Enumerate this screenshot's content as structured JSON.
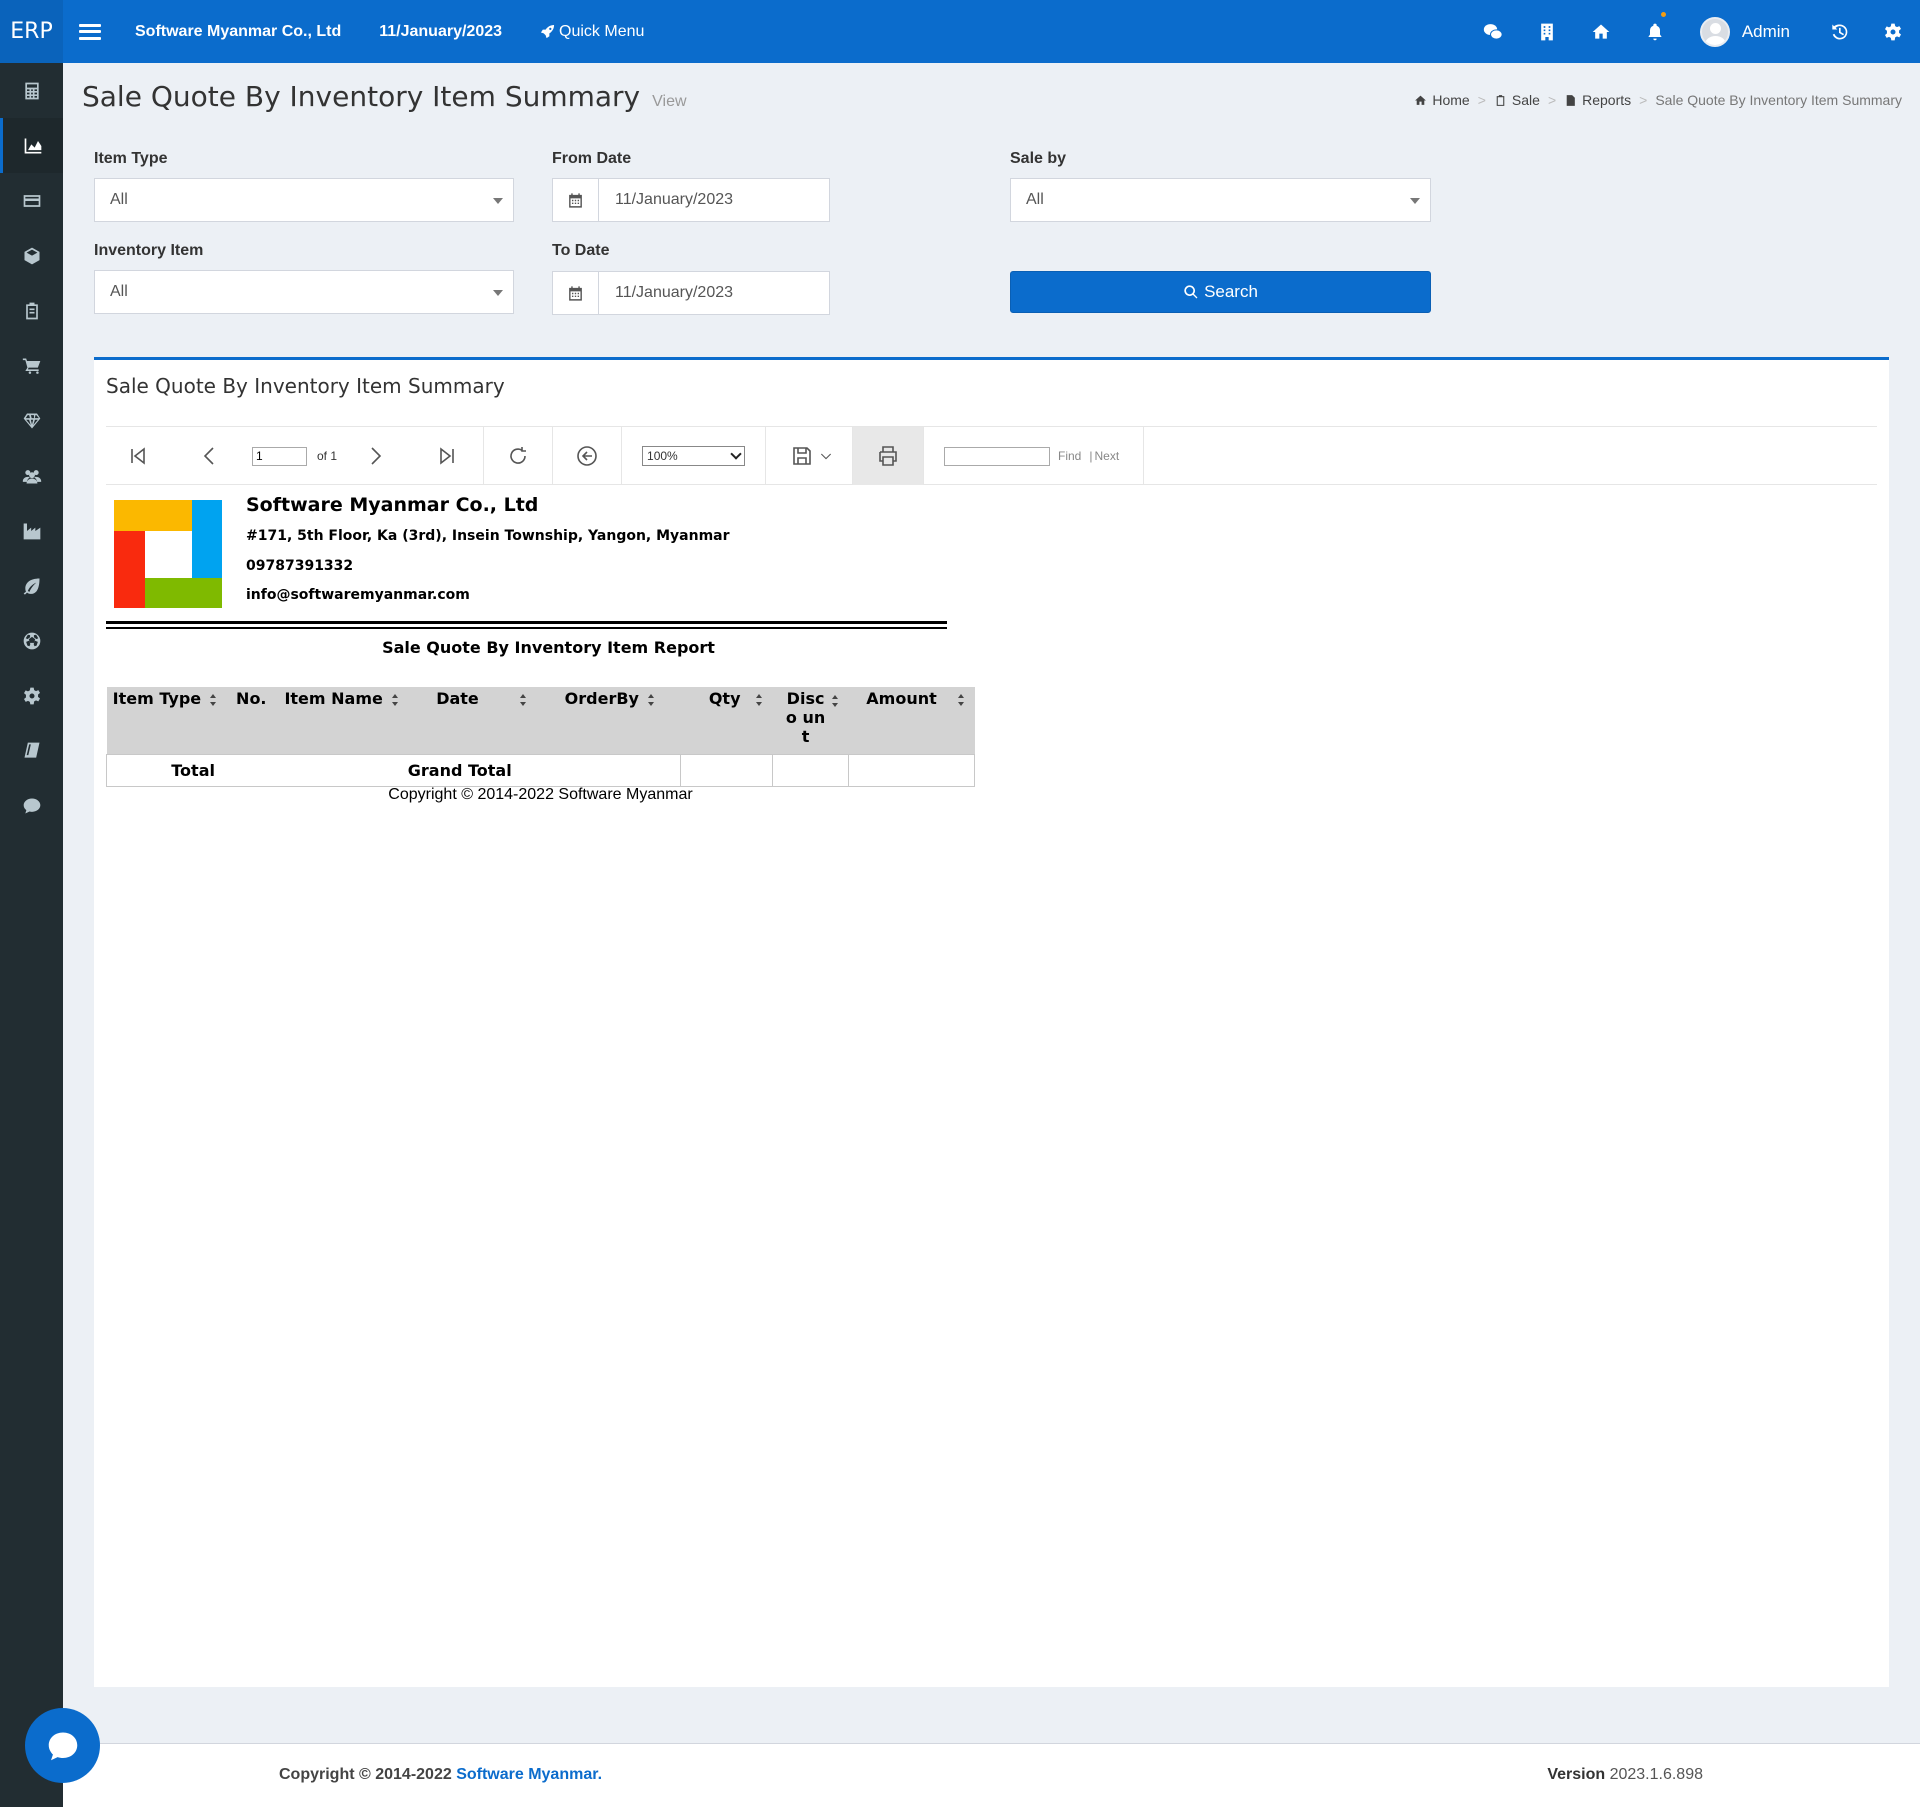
{
  "app": {
    "brand": "ERP",
    "company": "Software Myanmar Co., Ltd",
    "date": "11/January/2023",
    "quick_menu": "Quick Menu",
    "user": "Admin"
  },
  "sidebar": {
    "items": [
      {
        "icon": "calculator-icon"
      },
      {
        "icon": "area-chart-icon",
        "active": true
      },
      {
        "icon": "credit-card-icon"
      },
      {
        "icon": "cube-icon"
      },
      {
        "icon": "clipboard-icon"
      },
      {
        "icon": "cart-icon"
      },
      {
        "icon": "diamond-icon"
      },
      {
        "icon": "users-icon"
      },
      {
        "icon": "industry-icon"
      },
      {
        "icon": "leaf-icon"
      },
      {
        "icon": "soccer-ball-icon"
      },
      {
        "icon": "cog-icon"
      },
      {
        "icon": "book-icon"
      },
      {
        "icon": "comment-icon"
      }
    ]
  },
  "header": {
    "title": "Sale Quote By Inventory Item Summary",
    "subtitle": "View",
    "breadcrumb": [
      "Home",
      "Sale",
      "Reports",
      "Sale Quote By Inventory Item Summary"
    ]
  },
  "filters": {
    "item_type_label": "Item Type",
    "item_type_value": "All",
    "inventory_item_label": "Inventory Item",
    "inventory_item_value": "All",
    "from_date_label": "From Date",
    "from_date_value": "11/January/2023",
    "to_date_label": "To Date",
    "to_date_value": "11/January/2023",
    "sale_by_label": "Sale by",
    "sale_by_value": "All",
    "search_label": "Search"
  },
  "report_box": {
    "title": "Sale Quote By Inventory Item Summary",
    "toolbar": {
      "page_value": "1",
      "page_of": "of 1",
      "zoom": "100%",
      "find_label": "Find",
      "next_label": "Next"
    }
  },
  "report": {
    "company": "Software Myanmar Co., Ltd",
    "address": "#171, 5th Floor, Ka (3rd), Insein Township, Yangon, Myanmar",
    "phone": "09787391332",
    "email": "info@softwaremyanmar.com",
    "title": "Sale Quote By Inventory Item Report",
    "columns": [
      "Item Type",
      "No.",
      "Item Name",
      "Date",
      "OrderBy",
      "Qty",
      "Disco unt",
      "Amount"
    ],
    "total_row": {
      "label": "Total",
      "grand_total": "Grand Total"
    },
    "copyright": "Copyright © 2014-2022 Software Myanmar",
    "logo_colors": [
      "#fbb800",
      "#00a3f0",
      "#f92a0e",
      "#7fba00"
    ]
  },
  "footer": {
    "copyright_prefix": "Copyright © 2014-2022 ",
    "copyright_link": "Software Myanmar.",
    "version_label": "Version",
    "version_value": "2023.1.6.898"
  },
  "colors": {
    "primary": "#0b6ccc",
    "sidebar": "#222d32",
    "background": "#ecf0f5"
  }
}
